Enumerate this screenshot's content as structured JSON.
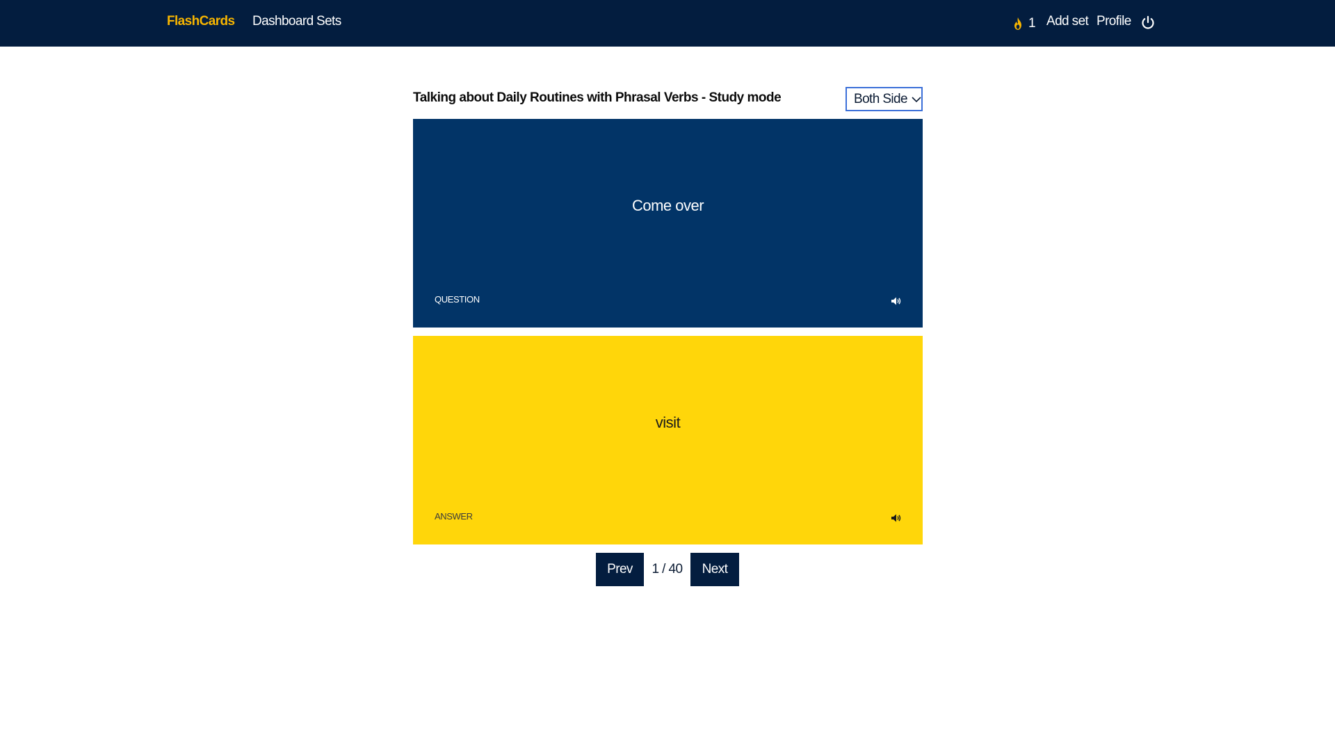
{
  "navbar": {
    "brand": "FlashCards",
    "links": {
      "dashboard": "Dashboard",
      "sets": "Sets"
    },
    "streak_count": "1",
    "add_set": "Add set",
    "profile": "Profile",
    "icons": {
      "streak": "flame-icon",
      "logout": "power-icon"
    }
  },
  "study": {
    "title": "Talking about Daily Routines with Phrasal Verbs - Study mode",
    "mode_select": {
      "selected": "Both Side",
      "icon": "chevron-down-icon"
    }
  },
  "cards": {
    "question": {
      "text": "Come over",
      "side_label": "QUESTION",
      "icon": "speaker-icon"
    },
    "answer": {
      "text": "visit",
      "side_label": "ANSWER",
      "icon": "speaker-icon"
    }
  },
  "pager": {
    "prev": "Prev",
    "next": "Next",
    "counter": "1 / 40"
  },
  "colors": {
    "navbar": "#031d3f",
    "brand": "#f7b500",
    "question_card": "#023467",
    "answer_card": "#ffd60a",
    "select_border": "#3b6fd8"
  }
}
